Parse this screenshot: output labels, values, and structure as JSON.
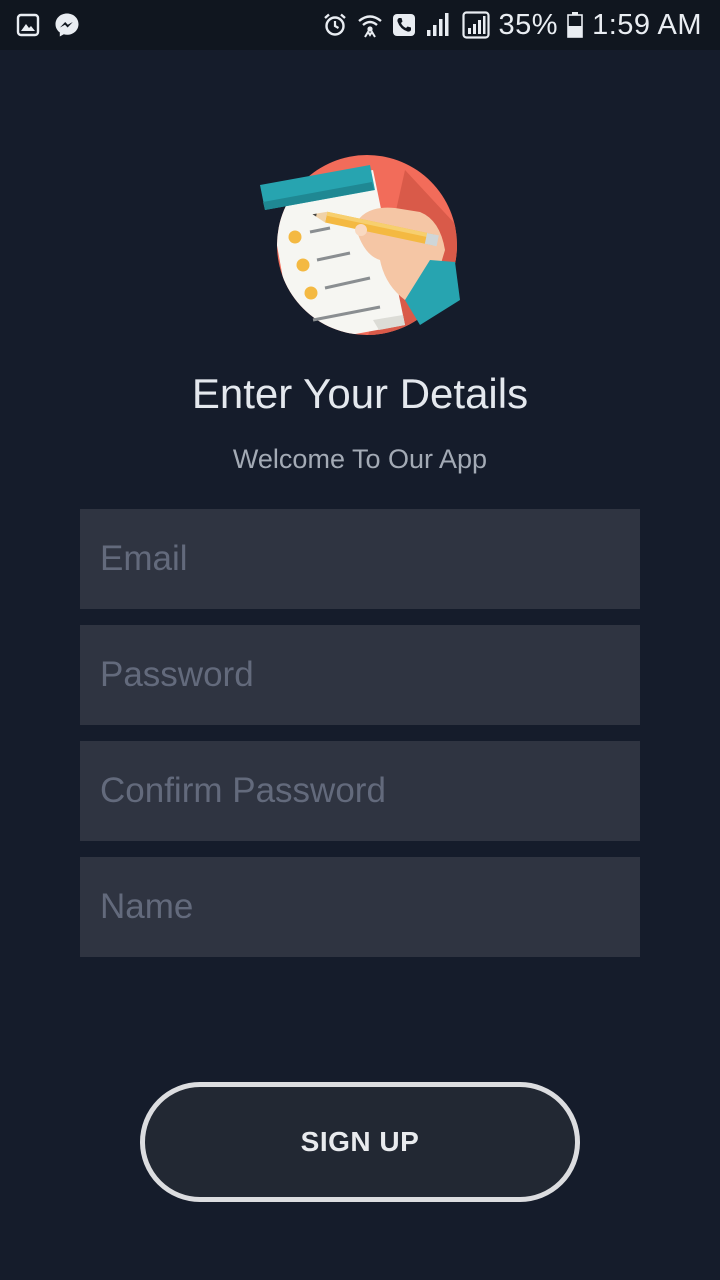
{
  "status_bar": {
    "left_icons": [
      "gallery-icon",
      "messenger-icon"
    ],
    "right_icons": [
      "alarm-icon",
      "wifi-call-icon",
      "phone-call-icon",
      "signal-icon",
      "signal-icon-2",
      "battery-icon"
    ],
    "battery": "35%",
    "time": "1:59 AM"
  },
  "hero": {
    "icon": "notepad-writing-illustration"
  },
  "header": {
    "title": "Enter Your Details",
    "subtitle": "Welcome To Our App"
  },
  "form": {
    "email_placeholder": "Email",
    "password_placeholder": "Password",
    "confirm_password_placeholder": "Confirm Password",
    "name_placeholder": "Name",
    "submit_label": "SIGN UP"
  },
  "colors": {
    "background": "#151c2b",
    "field_background": "#2f3441",
    "illustration_accent": "#f26c5a",
    "teal": "#27a4b0"
  }
}
